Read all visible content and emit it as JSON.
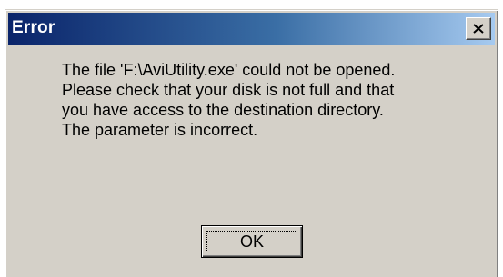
{
  "dialog": {
    "title": "Error",
    "close_icon": "close-icon",
    "message_lines": [
      "The file 'F:\\AviUtility.exe' could not be opened.",
      "Please check that your disk is not full and that",
      "you have access to the destination directory.",
      "The parameter is incorrect."
    ],
    "ok_label": "OK"
  },
  "colors": {
    "titlebar_start": "#0a246a",
    "titlebar_end": "#a6caf0",
    "face": "#d4d0c8"
  }
}
